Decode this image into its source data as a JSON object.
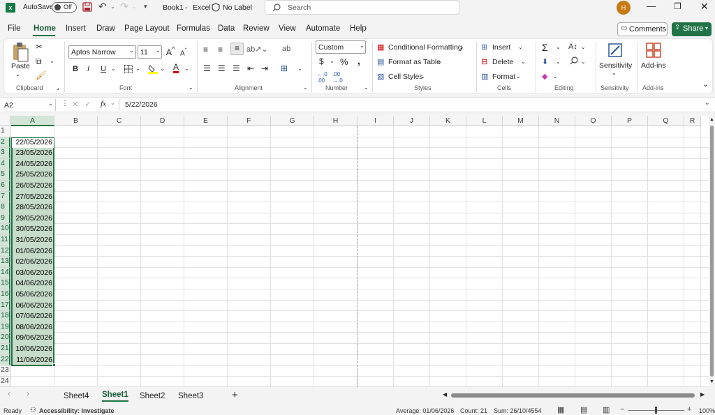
{
  "titlebar": {
    "autosave": "AutoSave",
    "toggle": "Off",
    "filename": "Book1",
    "separator": "-",
    "app": "Excel",
    "label": "No Label",
    "search_placeholder": "Search",
    "avatar": "H"
  },
  "menu": {
    "items": [
      "File",
      "Home",
      "Insert",
      "Draw",
      "Page Layout",
      "Formulas",
      "Data",
      "Review",
      "View",
      "Automate",
      "Help"
    ],
    "active": "Home",
    "comments": "Comments",
    "share": "Share"
  },
  "ribbon": {
    "clipboard": {
      "paste": "Paste",
      "label": "Clipboard"
    },
    "font": {
      "name": "Aptos Narrow",
      "size": "11",
      "label": "Font",
      "bold": "B",
      "italic": "I",
      "underline": "U",
      "grow": "A",
      "shrink": "A"
    },
    "alignment": {
      "label": "Alignment"
    },
    "number": {
      "format": "Custom",
      "currency": "$",
      "percent": "%",
      "comma": ",",
      "label": "Number"
    },
    "styles": {
      "conditional": "Conditional Formatting",
      "table": "Format as Table",
      "cell": "Cell Styles",
      "label": "Styles"
    },
    "cells": {
      "insert": "Insert",
      "delete": "Delete",
      "format": "Format",
      "label": "Cells"
    },
    "editing": {
      "label": "Editing"
    },
    "sensitivity": {
      "name": "Sensitivity",
      "label": "Sensitivity"
    },
    "addins": {
      "name": "Add-ins",
      "label": "Add-ins"
    }
  },
  "formula": {
    "namebox": "A2",
    "fx": "fx",
    "value": "5/22/2026"
  },
  "columns": [
    "A",
    "B",
    "C",
    "D",
    "E",
    "F",
    "G",
    "H",
    "I",
    "J",
    "K",
    "L",
    "M",
    "N",
    "O",
    "P",
    "Q",
    "R"
  ],
  "rows": [
    "1",
    "2",
    "3",
    "4",
    "5",
    "6",
    "7",
    "8",
    "9",
    "10",
    "11",
    "12",
    "13",
    "14",
    "15",
    "16",
    "17",
    "18",
    "19",
    "20",
    "21",
    "22",
    "23",
    "24"
  ],
  "cells": [
    "22/05/2026",
    "23/05/2026",
    "24/05/2026",
    "25/05/2026",
    "26/05/2026",
    "27/05/2026",
    "28/05/2026",
    "29/05/2026",
    "30/05/2026",
    "31/05/2026",
    "01/06/2026",
    "02/06/2026",
    "03/06/2026",
    "04/06/2026",
    "05/06/2026",
    "06/06/2026",
    "07/06/2026",
    "08/06/2026",
    "09/06/2026",
    "10/06/2026",
    "11/06/2026"
  ],
  "sheets": [
    "Sheet4",
    "Sheet1",
    "Sheet2",
    "Sheet3"
  ],
  "active_sheet": "Sheet1",
  "add_sheet": "+",
  "status": {
    "ready": "Ready",
    "accessibility": "Accessibility: Investigate",
    "average": "Average: 01/06/2026",
    "count": "Count: 21",
    "sum": "Sum: 26/10/4554",
    "zoom": "100%"
  },
  "colors": {
    "accent": "#217346",
    "selection": "#c6dcc9"
  }
}
